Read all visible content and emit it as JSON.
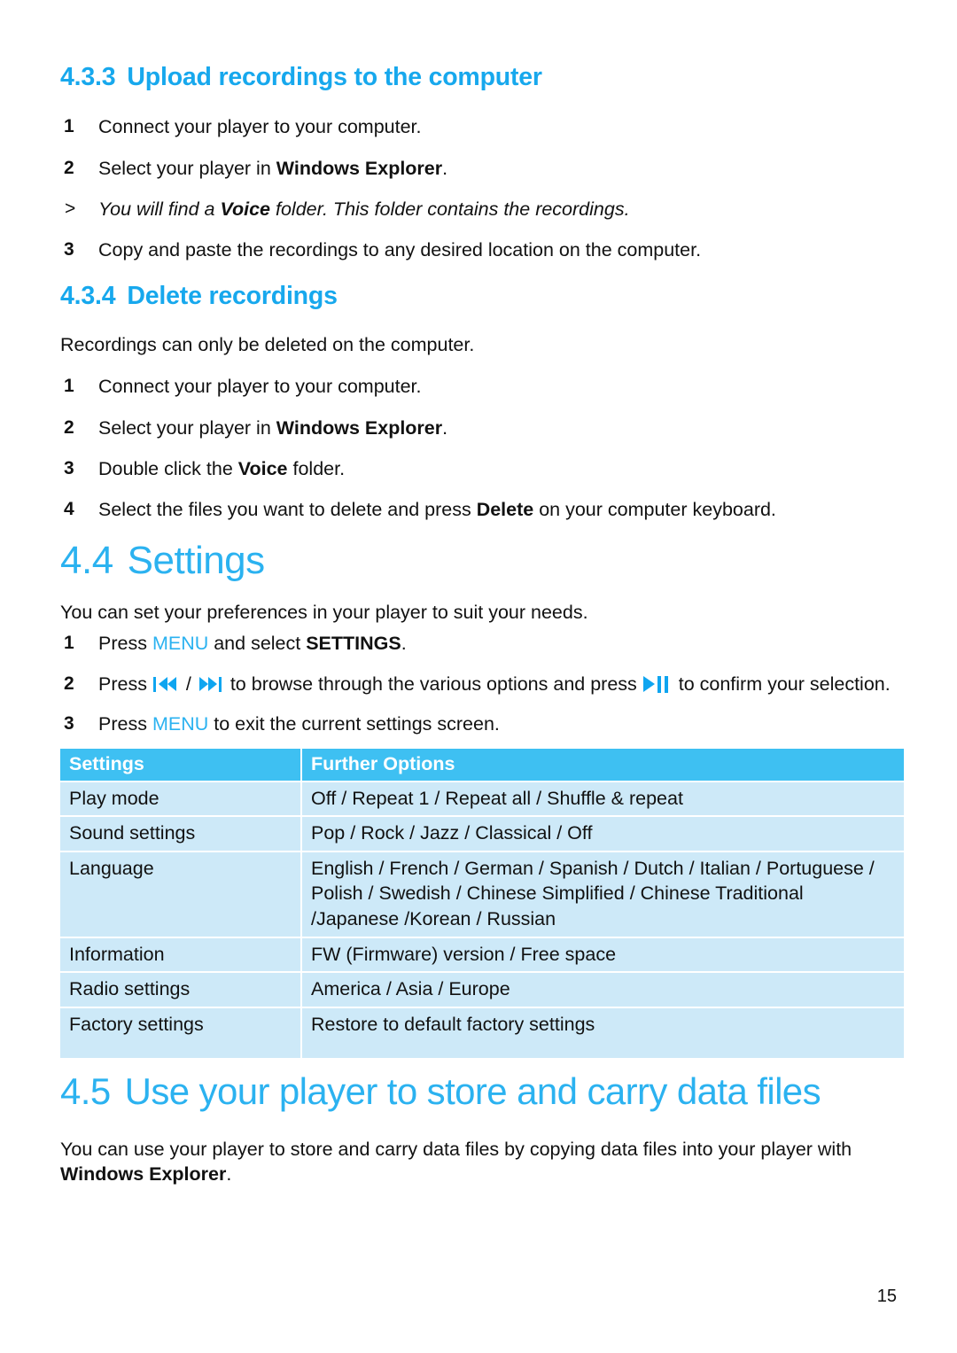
{
  "colors": {
    "heading_blue": "#17A8ED",
    "title_blue": "#2BB2F0",
    "table_header_bg": "#3EC0F2",
    "table_row_bg": "#CDE9F8",
    "icon_blue": "#0FA5F0",
    "text_black": "#111111"
  },
  "section_433": {
    "number": "4.3.3",
    "title": "Upload recordings to the computer",
    "steps": [
      {
        "marker": "1",
        "text": "Connect your player to your computer."
      },
      {
        "marker": "2",
        "pre": "Select your player in ",
        "bold": "Windows Explorer",
        "post": "."
      },
      {
        "marker": ">",
        "note": true,
        "pre": "You will find a ",
        "bold": "Voice",
        "post": " folder. This folder contains the recordings."
      },
      {
        "marker": "3",
        "text": "Copy and paste the recordings to any desired location on the computer."
      }
    ]
  },
  "section_434": {
    "number": "4.3.4",
    "title": "Delete recordings",
    "intro": "Recordings can only be deleted on the computer.",
    "steps": [
      {
        "marker": "1",
        "text": "Connect your player to your computer."
      },
      {
        "marker": "2",
        "pre": "Select your player in ",
        "bold": "Windows Explorer",
        "post": "."
      },
      {
        "marker": "3",
        "pre": "Double click the ",
        "bold": "Voice",
        "post": " folder."
      },
      {
        "marker": "4",
        "pre": "Select the files you want to delete and press ",
        "bold": "Delete",
        "post": " on your computer keyboard."
      }
    ]
  },
  "section_44": {
    "number": "4.4",
    "title": "Settings",
    "intro": "You can set your preferences in your player to suit your needs.",
    "step1": {
      "marker": "1",
      "pre": "Press ",
      "menu": "MENU",
      "mid": " and select ",
      "bold": "SETTINGS",
      "post": "."
    },
    "step2": {
      "marker": "2",
      "pre": "Press ",
      "icon_prev": "previous-track-icon",
      "sep": " / ",
      "icon_next": "next-track-icon",
      "mid": " to browse through the various options and press ",
      "icon_play": "play-pause-icon",
      "post": " to confirm your selection."
    },
    "step3": {
      "marker": "3",
      "pre": "Press ",
      "menu": "MENU",
      "post": " to exit the current settings screen."
    },
    "table": {
      "headers": [
        "Settings",
        "Further Options"
      ],
      "rows": [
        {
          "setting": "Play mode",
          "options": [
            "Off / Repeat 1 / Repeat all / Shuffle & repeat"
          ]
        },
        {
          "setting": "Sound settings",
          "options": [
            "Pop / Rock / Jazz / Classical / Off"
          ]
        },
        {
          "setting": "Language",
          "options": [
            "English / French / German / Spanish / Dutch / Italian / Portuguese /",
            "Polish / Swedish / Chinese Simplified / Chinese Traditional",
            "/Japanese /Korean / Russian"
          ]
        },
        {
          "setting": "Information",
          "options": [
            "FW (Firmware) version / Free space"
          ]
        },
        {
          "setting": "Radio settings",
          "options": [
            "America / Asia / Europe"
          ]
        },
        {
          "setting": "Factory settings",
          "options": [
            "Restore to default factory settings"
          ]
        }
      ]
    }
  },
  "section_45": {
    "number": "4.5",
    "title": "Use your player to store and carry data files",
    "body_pre": "You can use your player to store and carry data files by copying data files into your player with ",
    "body_bold": "Windows Explorer",
    "body_post": "."
  },
  "footer": {
    "page_number": "15"
  }
}
